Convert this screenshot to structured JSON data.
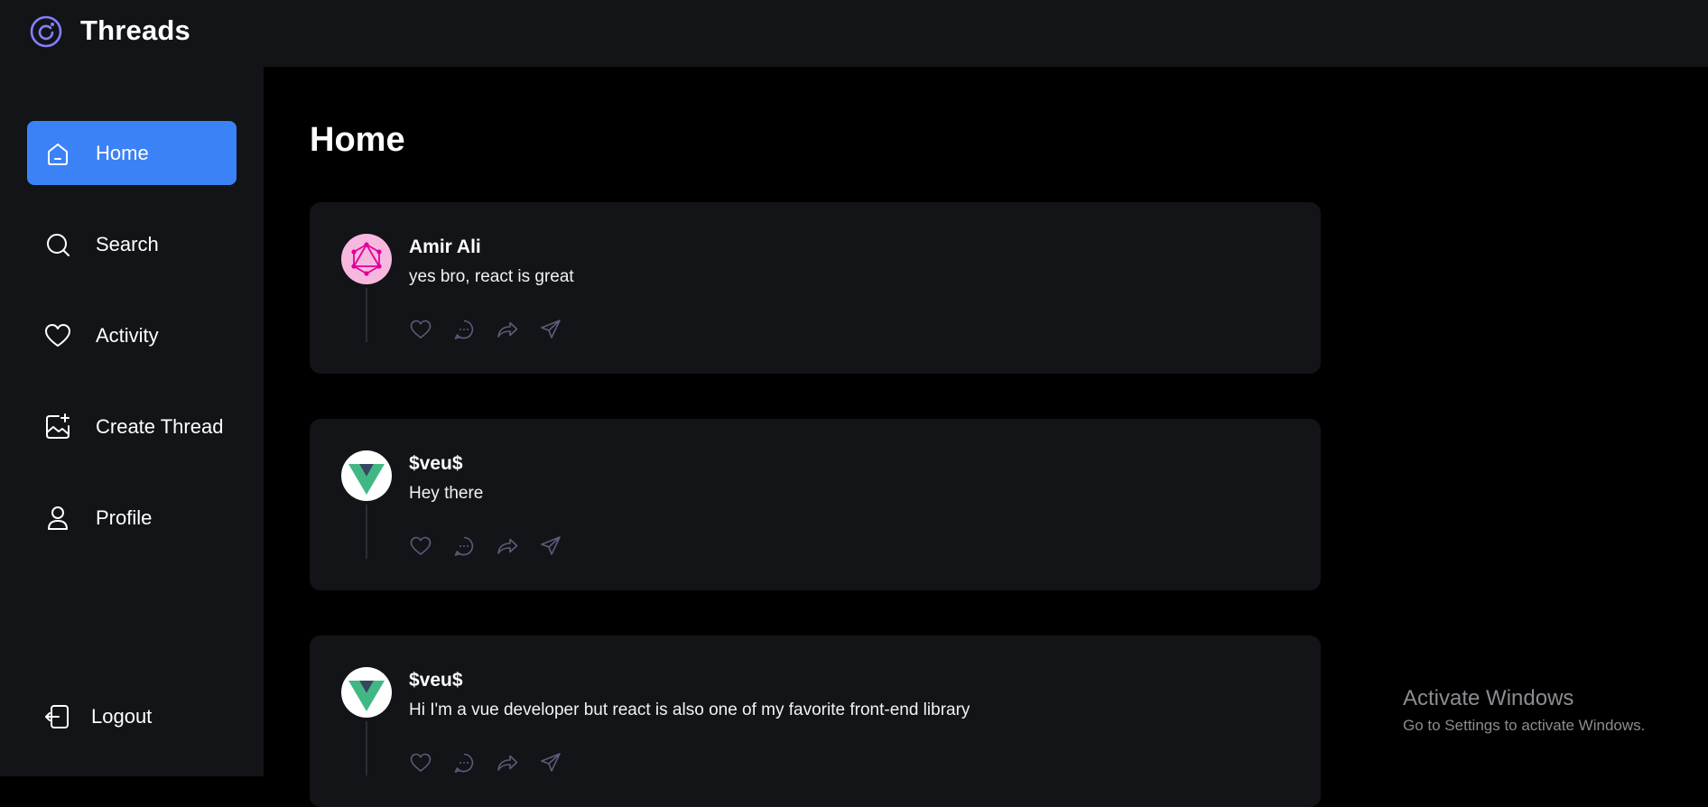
{
  "app": {
    "title": "Threads"
  },
  "sidebar": {
    "items": [
      {
        "label": "Home",
        "icon": "home-icon",
        "active": true
      },
      {
        "label": "Search",
        "icon": "search-icon",
        "active": false
      },
      {
        "label": "Activity",
        "icon": "heart-icon",
        "active": false
      },
      {
        "label": "Create Thread",
        "icon": "image-add-icon",
        "active": false
      },
      {
        "label": "Profile",
        "icon": "user-icon",
        "active": false
      }
    ],
    "logout_label": "Logout"
  },
  "main": {
    "title": "Home",
    "threads": [
      {
        "author": "Amir Ali",
        "text": "yes bro, react is great",
        "avatar": "graphql-logo-avatar"
      },
      {
        "author": "$veu$",
        "text": "Hey there",
        "avatar": "vue-logo-avatar"
      },
      {
        "author": "$veu$",
        "text": "Hi I'm a vue developer but react is also one of my favorite front-end library",
        "avatar": "vue-logo-avatar"
      }
    ]
  },
  "watermark": {
    "line1": "Activate Windows",
    "line2": "Go to Settings to activate Windows."
  },
  "colors": {
    "accent": "#3b82f6",
    "panel": "#121417",
    "background": "#000000",
    "logo": "#877eff"
  }
}
